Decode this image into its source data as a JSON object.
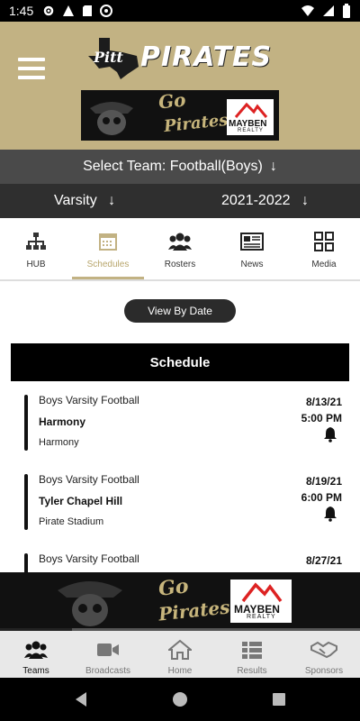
{
  "status_bar": {
    "time": "1:45"
  },
  "header": {
    "logo_pitt": "Pitt",
    "logo_pirates": "PIRATES",
    "banner": {
      "go": "Go",
      "pirates": "Pirates!",
      "sponsor": "MAYBEN",
      "sponsor_sub": "REALTY"
    }
  },
  "selectors": {
    "team_label": "Select Team: Football(Boys)",
    "level": "Varsity",
    "season": "2021-2022"
  },
  "tabs": [
    {
      "label": "HUB",
      "icon": "hierarchy-icon",
      "active": false
    },
    {
      "label": "Schedules",
      "icon": "calendar-icon",
      "active": true
    },
    {
      "label": "Rosters",
      "icon": "people-icon",
      "active": false
    },
    {
      "label": "News",
      "icon": "newspaper-icon",
      "active": false
    },
    {
      "label": "Media",
      "icon": "grid-icon",
      "active": false
    }
  ],
  "view_by_date_label": "View By Date",
  "schedule_title": "Schedule",
  "games": [
    {
      "sport": "Boys Varsity Football",
      "opponent": "Harmony",
      "location": "Harmony",
      "date": "8/13/21",
      "time": "5:00 PM"
    },
    {
      "sport": "Boys Varsity Football",
      "opponent": "Tyler Chapel Hill",
      "location": "Pirate Stadium",
      "date": "8/19/21",
      "time": "6:00 PM"
    },
    {
      "sport": "Boys Varsity Football",
      "opponent": "",
      "location": "",
      "date": "8/27/21",
      "time": ""
    }
  ],
  "bottom_banner": {
    "go": "Go",
    "pirates": "Pirates!",
    "sponsor": "MAYBEN",
    "sponsor_sub": "REALTY"
  },
  "bottom_nav": [
    {
      "label": "Teams",
      "icon": "team-icon",
      "active": true
    },
    {
      "label": "Broadcasts",
      "icon": "video-camera-icon",
      "active": false
    },
    {
      "label": "Home",
      "icon": "home-icon",
      "active": false
    },
    {
      "label": "Results",
      "icon": "list-icon",
      "active": false
    },
    {
      "label": "Sponsors",
      "icon": "handshake-icon",
      "active": false
    }
  ],
  "colors": {
    "gold": "#c2b283",
    "dark_gray": "#4a4a4a",
    "darker_gray": "#2f2f2f",
    "black": "#000000"
  }
}
